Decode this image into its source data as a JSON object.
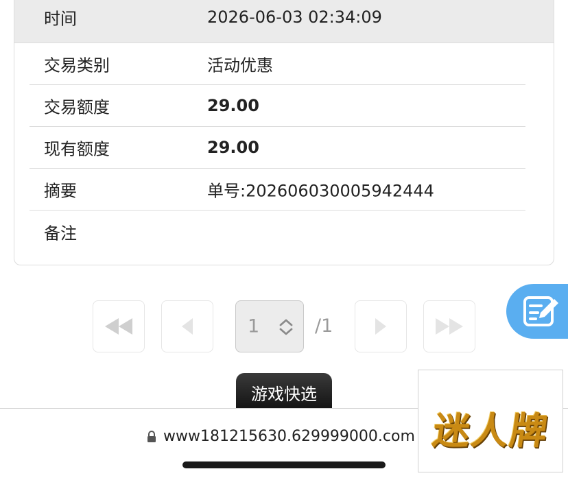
{
  "record": {
    "time_label": "时间",
    "time_value": "2026-06-03 02:34:09",
    "rows": [
      {
        "label": "交易类别",
        "value": "活动优惠"
      },
      {
        "label": "交易额度",
        "value": "29.00"
      },
      {
        "label": "现有额度",
        "value": "29.00"
      },
      {
        "label": "摘要",
        "value": "单号:202606030005942444"
      },
      {
        "label": "备注",
        "value": ""
      }
    ]
  },
  "pagination": {
    "current_page": "1",
    "total_pages": "/1",
    "icons": [
      "first-page-icon",
      "prev-page-icon",
      "updown-icon",
      "next-page-icon",
      "last-page-icon"
    ]
  },
  "quick_select": {
    "label": "游戏快选"
  },
  "browser": {
    "url": "www181215630.629999000.com"
  },
  "ad": {
    "logo_text": "迷人牌"
  },
  "colors": {
    "fab": "#5aaef0",
    "logo_gold": "#c98a14",
    "header_bg": "#ebebeb"
  }
}
